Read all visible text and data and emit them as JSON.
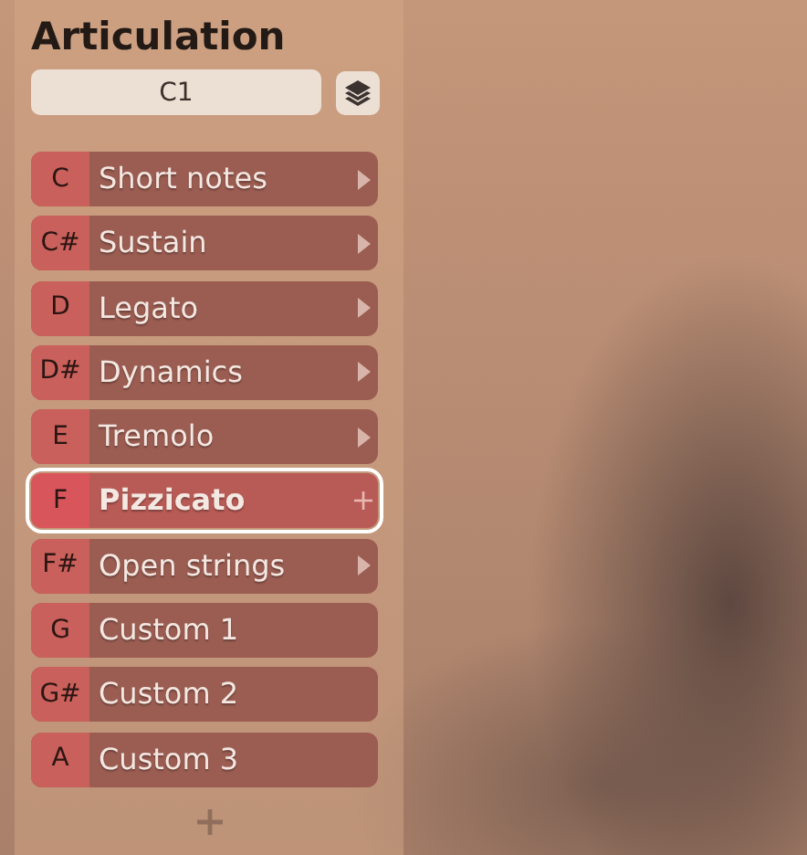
{
  "panel": {
    "title": "Articulation",
    "field": {
      "value": "C1"
    }
  },
  "items": [
    {
      "note": "C",
      "label": "Short notes",
      "kind": "submenu",
      "selected": false
    },
    {
      "note": "C#",
      "label": "Sustain",
      "kind": "submenu",
      "selected": false
    },
    {
      "note": "D",
      "label": "Legato",
      "kind": "submenu",
      "selected": false
    },
    {
      "note": "D#",
      "label": "Dynamics",
      "kind": "submenu",
      "selected": false
    },
    {
      "note": "E",
      "label": "Tremolo",
      "kind": "submenu",
      "selected": false
    },
    {
      "note": "F",
      "label": "Pizzicato",
      "kind": "add",
      "selected": true
    },
    {
      "note": "F#",
      "label": "Open strings",
      "kind": "submenu",
      "selected": false
    },
    {
      "note": "G",
      "label": "Custom 1",
      "kind": "plain",
      "selected": false
    },
    {
      "note": "G#",
      "label": "Custom 2",
      "kind": "plain",
      "selected": false
    },
    {
      "note": "A",
      "label": "Custom 3",
      "kind": "plain",
      "selected": false
    }
  ]
}
